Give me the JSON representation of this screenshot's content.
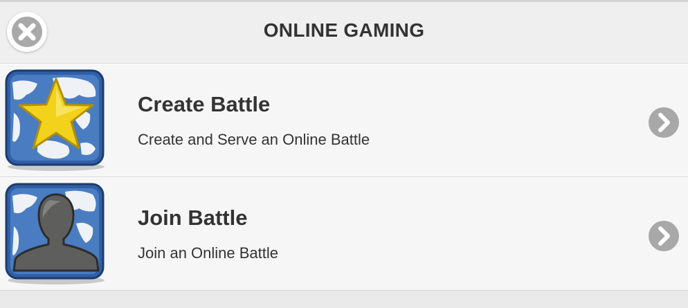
{
  "header": {
    "title": "ONLINE GAMING",
    "close_icon": "close-icon"
  },
  "items": [
    {
      "title": "Create Battle",
      "description": "Create and Serve an Online Battle",
      "icon": "globe-star-icon"
    },
    {
      "title": "Join Battle",
      "description": "Join an Online Battle",
      "icon": "globe-person-icon"
    }
  ],
  "colors": {
    "header_bg": "#efefef",
    "item_bg": "#f6f6f6",
    "text": "#333333",
    "icon_blue": "#2f5fa6",
    "star_yellow": "#f2d21b",
    "chevron_gray": "#a8a8a8"
  }
}
